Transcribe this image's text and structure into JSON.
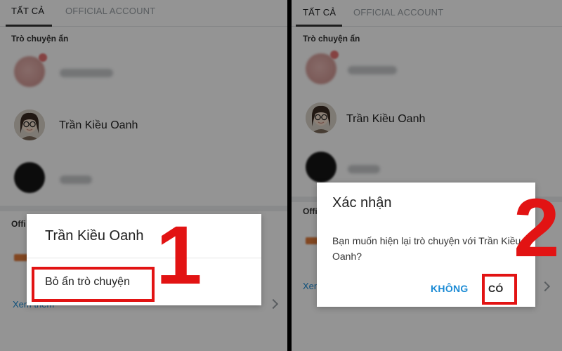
{
  "tabs": {
    "all": "TẤT CẢ",
    "official": "OFFICIAL ACCOUNT"
  },
  "hidden_section_title": "Trò chuyện ẩn",
  "official_section_title": "Offi",
  "contact_name": "Trần Kiều Oanh",
  "see_more": "Xem thêm",
  "see_more_short": "Xen",
  "menu_dialog": {
    "title": "Trần Kiều Oanh",
    "unhide_label": "Bỏ ẩn trò chuyện"
  },
  "confirm_dialog": {
    "title": "Xác nhận",
    "message": "Bạn muốn hiện lại trò chuyện với Trần Kiều Oanh?",
    "no_label": "KHÔNG",
    "yes_label": "CÓ"
  },
  "step_labels": {
    "step1": "1",
    "step2": "2"
  },
  "colors": {
    "highlight": "#e21313",
    "accent": "#1a8ad4"
  }
}
